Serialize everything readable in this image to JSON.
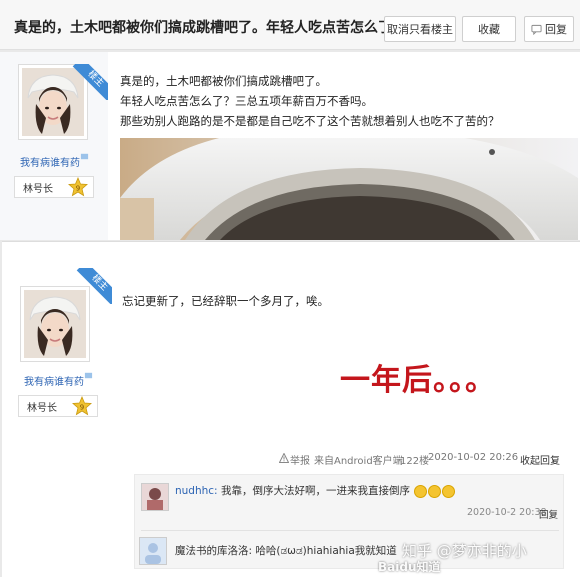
{
  "header": {
    "title": "真是的，土木吧都被你们搞成跳槽吧了。年轻人吃点苦怎么了...",
    "only_op_label": "取消只看楼主",
    "favorite_label": "收藏",
    "reply_label": "回复"
  },
  "post1": {
    "badge": "楼主",
    "username": "我有病谁有药",
    "rank_title": "林号长",
    "level": "9",
    "lines": [
      "真是的，土木吧都被你们搞成跳槽吧了。",
      "年轻人吃点苦怎么了？三总五项年薪百万不香吗。",
      "那些劝别人跑路的是不是都是自己吃不了这个苦就想着别人也吃不了苦的？"
    ]
  },
  "post2": {
    "badge": "楼主",
    "username": "我有病谁有药",
    "rank_title": "林号长",
    "level": "9",
    "text": "忘记更新了，已经辞职一个多月了，唉。",
    "overlay_caption": "一年后。。。",
    "report_label": "举报",
    "client_label": "来自Android客户端",
    "floor": "122楼",
    "datetime": "2020-10-02 20:26",
    "collapse_reply_label": "收起回复",
    "comments": [
      {
        "user": "nudhhc:",
        "text": "我靠，倒序大法好啊，一进来我直接倒序",
        "datetime": "2020-10-2 20:38",
        "reply_label": "回复"
      },
      {
        "user": "魔法书的库洛洛:",
        "text": "哈哈(ಡωಡ)hiahiahia我就知道"
      }
    ]
  },
  "watermarks": {
    "zhihu": "知乎 @梦亦非的小",
    "baidu": "Baidu知道"
  },
  "colors": {
    "link_blue": "#2d64b3",
    "caption_red": "#c4161c",
    "badge_blue": "#3f8bd6"
  }
}
